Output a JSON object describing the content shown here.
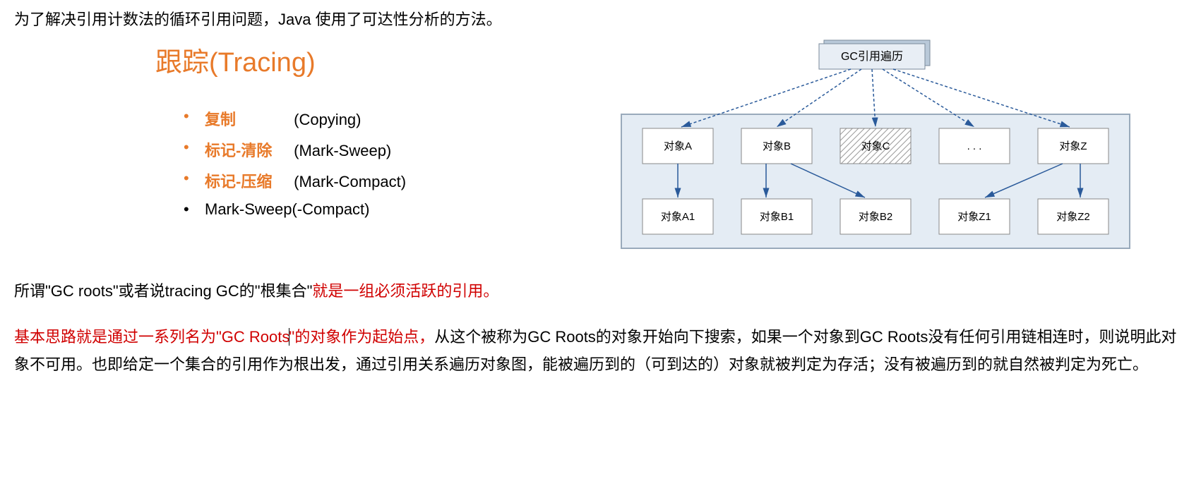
{
  "intro": "为了解决引用计数法的循环引用问题，Java 使用了可达性分析的方法。",
  "tracing_title": "跟踪(Tracing)",
  "bullets": [
    {
      "bold": "复制",
      "paren": "(Copying)",
      "plain": false
    },
    {
      "bold": "标记-清除",
      "paren": "(Mark-Sweep)",
      "plain": false
    },
    {
      "bold": "标记-压缩",
      "paren": "(Mark-Compact)",
      "plain": false
    },
    {
      "bold": "",
      "paren": "Mark-Sweep(-Compact)",
      "plain": true
    }
  ],
  "diagram": {
    "root": "GC引用遍历",
    "row1": [
      "对象A",
      "对象B",
      "对象C",
      ". . .",
      "对象Z"
    ],
    "row2": [
      "对象A1",
      "对象B1",
      "对象B2",
      "对象Z1",
      "对象Z2"
    ]
  },
  "para1": {
    "p1": "所谓\"GC roots\"或者说tracing GC的\"根集合\"",
    "p2": "就是一组必须活跃的引用。"
  },
  "para2": {
    "p1": "基本思路就是通过一系列名为\"GC Roots",
    "p2": "\"的对象作为起始点，",
    "p3": "从这个被称为GC Roots的对象开始向下搜索，如果一个对象到GC Roots没有任何引用链相连时，则说明此对象不可用。也即给定一个集合的引用作为根出发，通过引用关系遍历对象图，能被遍历到的（可到达的）对象就被判定为存活；没有被遍历到的就自然被判定为死亡。"
  }
}
